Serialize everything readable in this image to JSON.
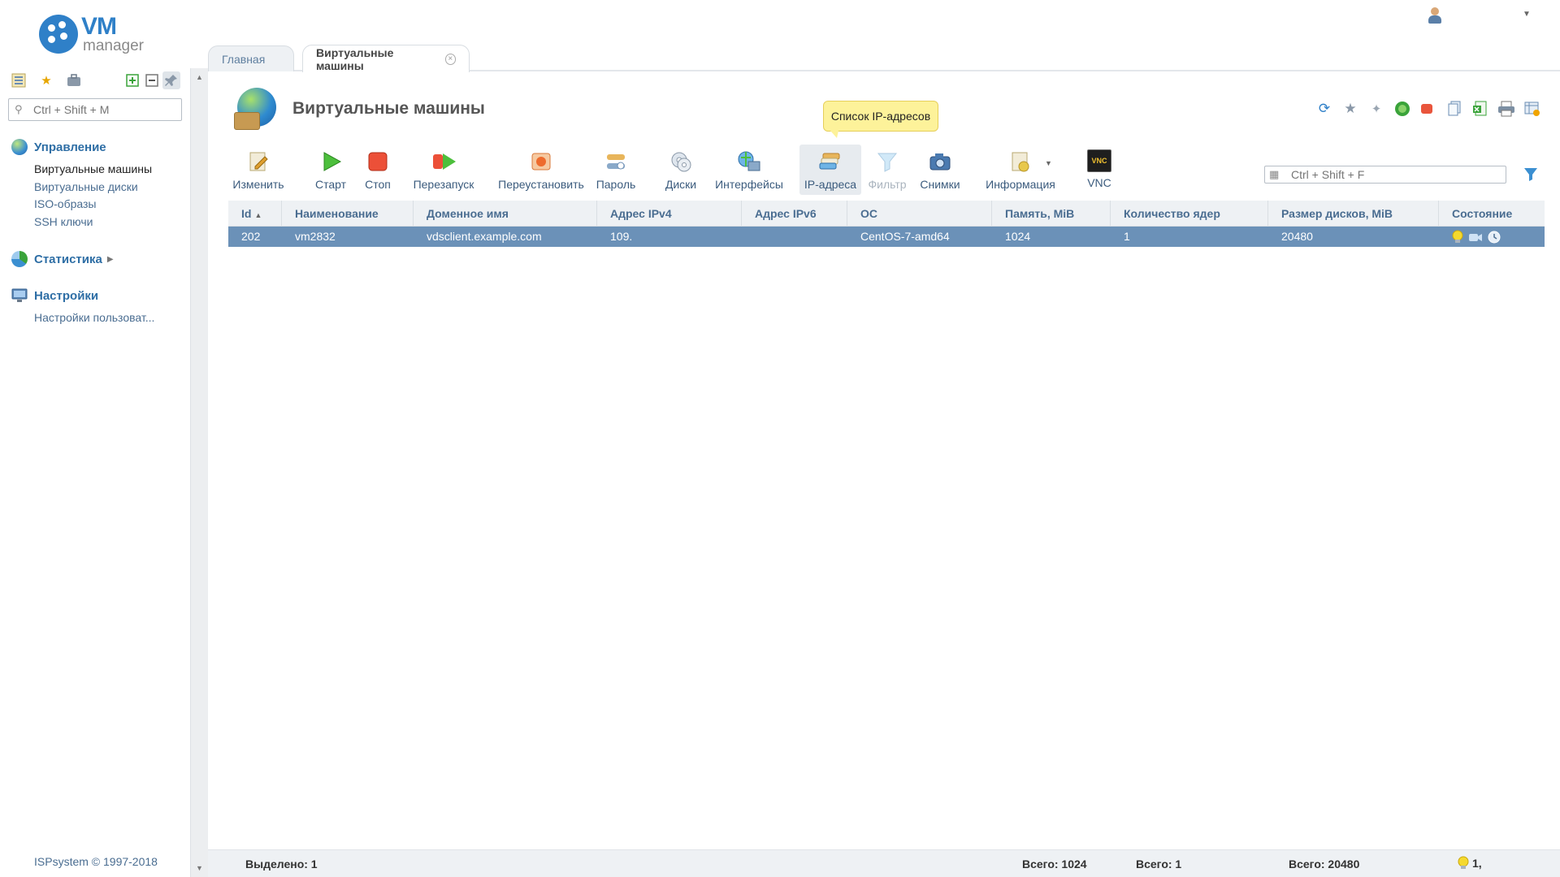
{
  "app": {
    "logo_main": "VM",
    "logo_sub": "manager"
  },
  "sidebar": {
    "search_placeholder": "Ctrl + Shift + M",
    "groups": [
      {
        "title": "Управление",
        "icon": "globe-icon",
        "items": [
          "Виртуальные машины",
          "Виртуальные диски",
          "ISO-образы",
          "SSH ключи"
        ]
      },
      {
        "title": "Статистика",
        "icon": "pie-chart-icon",
        "items": []
      },
      {
        "title": "Настройки",
        "icon": "settings-monitor-icon",
        "items": [
          "Настройки пользоват..."
        ]
      }
    ],
    "copyright": "ISPsystem © 1997-2018"
  },
  "tabs": [
    {
      "label": "Главная",
      "active": false
    },
    {
      "label": "Виртуальные машины",
      "active": true
    }
  ],
  "page": {
    "title": "Виртуальные машины"
  },
  "tooltip": "Список IP-адресов",
  "toolbar": [
    {
      "label": "Изменить",
      "icon": "edit-icon"
    },
    {
      "label": "Старт",
      "icon": "play-icon"
    },
    {
      "label": "Стоп",
      "icon": "stop-icon"
    },
    {
      "label": "Перезапуск",
      "icon": "restart-icon"
    },
    {
      "label": "Переустановить",
      "icon": "reinstall-icon"
    },
    {
      "label": "Пароль",
      "icon": "password-icon"
    },
    {
      "label": "Диски",
      "icon": "disks-icon"
    },
    {
      "label": "Интерфейсы",
      "icon": "interfaces-icon"
    },
    {
      "label": "IP-адреса",
      "icon": "ip-addresses-icon",
      "highlighted": true
    },
    {
      "label": "Фильтр",
      "icon": "filter-icon",
      "disabled": true
    },
    {
      "label": "Снимки",
      "icon": "snapshots-icon"
    },
    {
      "label": "Информация",
      "icon": "info-icon",
      "has_dropdown": true
    },
    {
      "label": "VNC",
      "icon": "vnc-icon",
      "icon_text": "VNC"
    }
  ],
  "filter": {
    "placeholder": "Ctrl + Shift + F"
  },
  "table": {
    "columns": [
      "Id",
      "Наименование",
      "Доменное имя",
      "Адрес IPv4",
      "Адрес IPv6",
      "ОС",
      "Память, MiB",
      "Количество ядер",
      "Размер дисков, MiB",
      "Состояние"
    ],
    "rows": [
      [
        "202",
        "vm2832",
        "vdsclient.example.com",
        "109.",
        "",
        "CentOS-7-amd64",
        "1024",
        "1",
        "20480",
        ""
      ]
    ]
  },
  "footer": {
    "selected": "Выделено: 1",
    "total_memory": "Всего: 1024",
    "total_cores": "Всего: 1",
    "total_disks": "Всего: 20480",
    "state_summary": "1,"
  },
  "colors": {
    "accent": "#2f80c8",
    "selected_row": "#6b91b8",
    "link": "#4a6d91"
  }
}
